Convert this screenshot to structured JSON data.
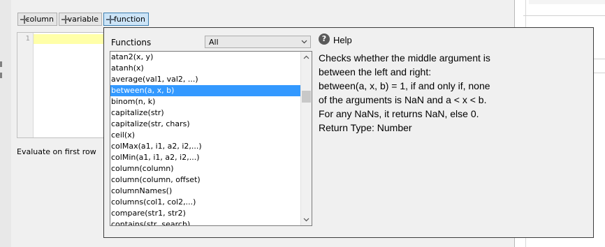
{
  "toolbar": {
    "column_label": "column",
    "variable_label": "variable",
    "function_label": "function"
  },
  "editor": {
    "line_number": "1",
    "evaluate_label": "Evaluate on first row"
  },
  "function_popup": {
    "functions_label": "Functions",
    "filter_selected": "All",
    "items": [
      "atan2(x, y)",
      "atanh(x)",
      "average(val1, val2, ...)",
      "between(a, x, b)",
      "binom(n, k)",
      "capitalize(str)",
      "capitalize(str, chars)",
      "ceil(x)",
      "colMax(a1, i1, a2, i2,...)",
      "colMin(a1, i1, a2, i2,...)",
      "column(column)",
      "column(column, offset)",
      "columnNames()",
      "columns(col1, col2,...)",
      "compare(str1, str2)",
      "contains(str, search)"
    ],
    "selected_index": 3,
    "help": {
      "icon_glyph": "?",
      "title": "Help",
      "lines": [
        "Checks whether the middle argument is",
        "between the left and right:",
        "between(a, x, b) = 1, if and only if, none",
        "of the arguments is NaN and a < x < b.",
        "For any NaNs, it returns NaN, else 0.",
        "Return Type: Number"
      ]
    }
  },
  "colors": {
    "selection": "#3399ff",
    "active_button": "#cce4f7",
    "current_line": "#ffffa8"
  }
}
